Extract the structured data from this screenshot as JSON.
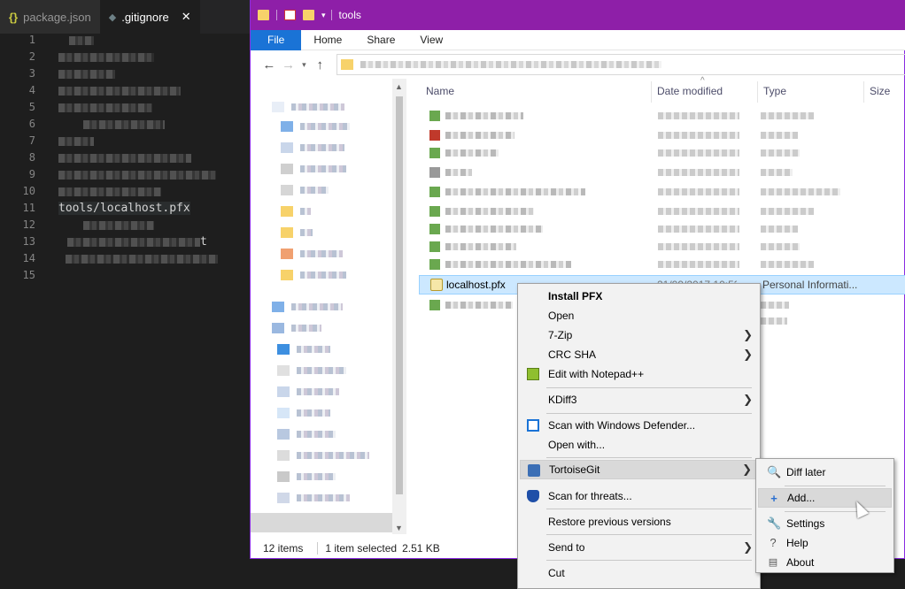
{
  "editor": {
    "tabs": [
      {
        "icon": "{}",
        "label": "package.json"
      },
      {
        "icon": "◆",
        "label": ".gitignore",
        "close": "✕"
      }
    ],
    "line_numbers": [
      "1",
      "2",
      "3",
      "4",
      "5",
      "6",
      "7",
      "8",
      "9",
      "10",
      "11",
      "12",
      "13",
      "14",
      "15"
    ],
    "highlight_line_text": "tools/localhost.pfx",
    "line13_tail": "t"
  },
  "explorer": {
    "title": "tools",
    "ribbon_tabs": [
      "File",
      "Home",
      "Share",
      "View"
    ],
    "columns": {
      "name": "Name",
      "date": "Date modified",
      "type": "Type",
      "size": "Size"
    },
    "selected_file": {
      "name": "localhost.pfx",
      "date": "21/09/2017 10:53",
      "type": "Personal Informati..."
    },
    "status": {
      "items": "12 items",
      "selected": "1 item selected",
      "size": "2.51 KB"
    }
  },
  "context_menu": {
    "items": [
      {
        "label": "Install PFX",
        "bold": true
      },
      {
        "label": "Open"
      },
      {
        "label": "7-Zip",
        "submenu": true
      },
      {
        "label": "CRC SHA",
        "submenu": true
      },
      {
        "label": "Edit with Notepad++",
        "icon": "notepad-plus-plus-icon"
      },
      {
        "label": "KDiff3",
        "submenu": true
      },
      {
        "label": "Scan with Windows Defender...",
        "icon": "windows-defender-icon"
      },
      {
        "label": "Open with..."
      },
      {
        "label": "TortoiseGit",
        "submenu": true,
        "icon": "tortoisegit-icon",
        "highlighted": true
      },
      {
        "label": "Scan for threats...",
        "icon": "shield-icon"
      },
      {
        "label": "Restore previous versions"
      },
      {
        "label": "Send to",
        "submenu": true
      },
      {
        "label": "Cut"
      }
    ],
    "submenu_arrow": "❯"
  },
  "tortoisegit_submenu": {
    "items": [
      {
        "label": "Diff later",
        "icon": "magnifier-icon"
      },
      {
        "label": "Add...",
        "icon": "add-icon",
        "highlighted": true
      },
      {
        "label": "Settings",
        "icon": "wrench-icon"
      },
      {
        "label": "Help",
        "icon": "help-icon"
      },
      {
        "label": "About",
        "icon": "about-icon"
      }
    ]
  },
  "colors": {
    "titlebar": "#8e1fa8",
    "file_tab": "#1a73d6",
    "selection": "#cce8ff",
    "editor_bg": "#1e1e1e"
  }
}
